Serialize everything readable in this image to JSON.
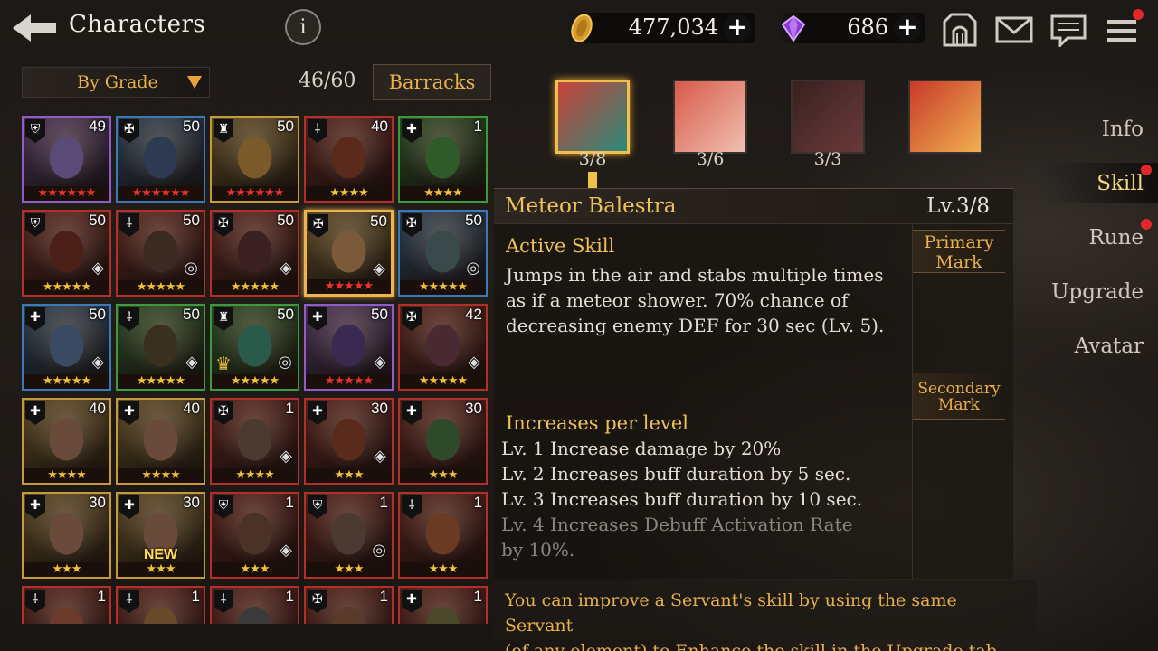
{
  "header": {
    "title": "Characters",
    "info_label": "i",
    "gold": "477,034",
    "gems": "686",
    "plus": "+"
  },
  "filter": {
    "sort_label": "By Grade",
    "count": "46/60",
    "barracks_label": "Barracks"
  },
  "characters": [
    {
      "level": "49",
      "stars": 6,
      "star_color": "#e8322c",
      "frame": "#8f5cc8",
      "bg": "#5a4a78",
      "cls": "⛨"
    },
    {
      "level": "50",
      "stars": 6,
      "star_color": "#e8322c",
      "frame": "#3b7ab8",
      "bg": "#2d3a52",
      "cls": "✠"
    },
    {
      "level": "50",
      "stars": 6,
      "star_color": "#e8322c",
      "frame": "#c59a3c",
      "bg": "#7a5a2a",
      "cls": "♜"
    },
    {
      "level": "40",
      "stars": 4,
      "star_color": "#f2c13c",
      "frame": "#b23028",
      "bg": "#5a2a1c",
      "cls": "⸸"
    },
    {
      "level": "1",
      "stars": 4,
      "star_color": "#f2c13c",
      "frame": "#3c9a3c",
      "bg": "#2f5a2a",
      "cls": "✚"
    },
    {
      "level": "50",
      "stars": 5,
      "star_color": "#f2c13c",
      "frame": "#b23028",
      "bg": "#4a2018",
      "cls": "⛨",
      "rune": "◈"
    },
    {
      "level": "50",
      "stars": 5,
      "star_color": "#f2c13c",
      "frame": "#b23028",
      "bg": "#3a2a22",
      "cls": "⸸",
      "rune": "◎"
    },
    {
      "level": "50",
      "stars": 5,
      "star_color": "#f2c13c",
      "frame": "#b23028",
      "bg": "#3a2020",
      "cls": "✠",
      "rune": "◈"
    },
    {
      "level": "50",
      "stars": 5,
      "star_color": "#e8322c",
      "frame": "#c59a3c",
      "bg": "#7a5a3a",
      "cls": "✠",
      "rune": "◈",
      "selected": true
    },
    {
      "level": "50",
      "stars": 5,
      "star_color": "#f2c13c",
      "frame": "#3b7ab8",
      "bg": "#3a4a4a",
      "cls": "✠",
      "rune": "◎"
    },
    {
      "level": "50",
      "stars": 5,
      "star_color": "#f2c13c",
      "frame": "#3b7ab8",
      "bg": "#3a4a62",
      "cls": "✚",
      "rune": "◈"
    },
    {
      "level": "50",
      "stars": 5,
      "star_color": "#f2c13c",
      "frame": "#3c9a3c",
      "bg": "#3a3020",
      "cls": "⸸",
      "rune": "◈"
    },
    {
      "level": "50",
      "stars": 5,
      "star_color": "#f2c13c",
      "frame": "#3c9a3c",
      "bg": "#2a5a4a",
      "cls": "♜",
      "rune": "◎",
      "crown": true
    },
    {
      "level": "50",
      "stars": 5,
      "star_color": "#e8322c",
      "frame": "#8f5cc8",
      "bg": "#3a2a52",
      "cls": "✚",
      "rune": "◈"
    },
    {
      "level": "42",
      "stars": 5,
      "star_color": "#f2c13c",
      "frame": "#b23028",
      "bg": "#4a2a32",
      "cls": "✠",
      "rune": "◈"
    },
    {
      "level": "40",
      "stars": 4,
      "star_color": "#f2c13c",
      "frame": "#c59a3c",
      "bg": "#6a4a3a",
      "cls": "✚"
    },
    {
      "level": "40",
      "stars": 4,
      "star_color": "#f2c13c",
      "frame": "#c59a3c",
      "bg": "#6a4a3a",
      "cls": "✚"
    },
    {
      "level": "1",
      "stars": 4,
      "star_color": "#f2c13c",
      "frame": "#b23028",
      "bg": "#4a3a30",
      "cls": "✠",
      "rune": "◈"
    },
    {
      "level": "30",
      "stars": 3,
      "star_color": "#f2c13c",
      "frame": "#b23028",
      "bg": "#5a2a1a",
      "cls": "✚",
      "rune": "◈"
    },
    {
      "level": "30",
      "stars": 3,
      "star_color": "#f2c13c",
      "frame": "#b23028",
      "bg": "#2f4a2a",
      "cls": "✚"
    },
    {
      "level": "30",
      "stars": 3,
      "star_color": "#f2c13c",
      "frame": "#c59a3c",
      "bg": "#6a4a3a",
      "cls": "✚"
    },
    {
      "level": "30",
      "stars": 3,
      "star_color": "#f2c13c",
      "frame": "#c59a3c",
      "bg": "#6a4a3a",
      "cls": "✚",
      "new": "NEW"
    },
    {
      "level": "1",
      "stars": 3,
      "star_color": "#f2c13c",
      "frame": "#b23028",
      "bg": "#4a3226",
      "cls": "⛨",
      "rune": "◈"
    },
    {
      "level": "1",
      "stars": 3,
      "star_color": "#f2c13c",
      "frame": "#b23028",
      "bg": "#4a3a32",
      "cls": "⛨",
      "rune": "◎"
    },
    {
      "level": "1",
      "stars": 3,
      "star_color": "#f2c13c",
      "frame": "#b23028",
      "bg": "#6a3a22",
      "cls": "⸸"
    },
    {
      "level": "1",
      "stars": 3,
      "star_color": "#f2c13c",
      "frame": "#b23028",
      "bg": "#6a3a2a",
      "cls": "⸸"
    },
    {
      "level": "1",
      "stars": 3,
      "star_color": "#f2c13c",
      "frame": "#b23028",
      "bg": "#6a4a2a",
      "cls": "⸸"
    },
    {
      "level": "1",
      "stars": 3,
      "star_color": "#f2c13c",
      "frame": "#b23028",
      "bg": "#3a3a3a",
      "cls": "⸸"
    },
    {
      "level": "1",
      "stars": 3,
      "star_color": "#f2c13c",
      "frame": "#b23028",
      "bg": "#5a3a2a",
      "cls": "✠"
    },
    {
      "level": "1",
      "stars": 3,
      "star_color": "#f2c13c",
      "frame": "#b23028",
      "bg": "#4a4a2a",
      "cls": "✚"
    }
  ],
  "skills": {
    "tabs": [
      {
        "count": "3/8",
        "color1": "#c8423a",
        "color2": "#2a8a7a"
      },
      {
        "count": "3/6",
        "color1": "#d85a4a",
        "color2": "#f0c0b0"
      },
      {
        "count": "3/3",
        "color1": "#3a2020",
        "color2": "#6a3a3a"
      },
      {
        "count": "",
        "color1": "#c83a2a",
        "color2": "#f0b050"
      }
    ],
    "name": "Meteor Balestra",
    "level": "Lv.3/8",
    "type": "Active Skill",
    "description": "Jumps in the air and stabs multiple times as if a meteor shower. 70% chance of decreasing enemy DEF for 30 sec (Lv. 5).",
    "per_level_title": "Increases per level",
    "per_level": [
      "Lv. 1 Increase damage by 20%",
      "Lv. 2 Increases buff duration by 5 sec.",
      "Lv. 3 Increases buff duration by 10 sec.",
      "Lv. 4 Increases Debuff Activation Rate",
      "by 10%."
    ],
    "primary_mark": [
      "Primary",
      "Mark"
    ],
    "secondary_mark": [
      "Secondary",
      "Mark"
    ],
    "hint_line1": "You can improve a Servant's skill by using the same Servant",
    "hint_line2": "(of any element) to Enhance the skill in the Upgrade tab."
  },
  "right_tabs": [
    "Info",
    "Skill",
    "Rune",
    "Upgrade",
    "Avatar"
  ],
  "accent_colors": {
    "gold": "#efc15a",
    "red_dot": "#e0272b"
  }
}
